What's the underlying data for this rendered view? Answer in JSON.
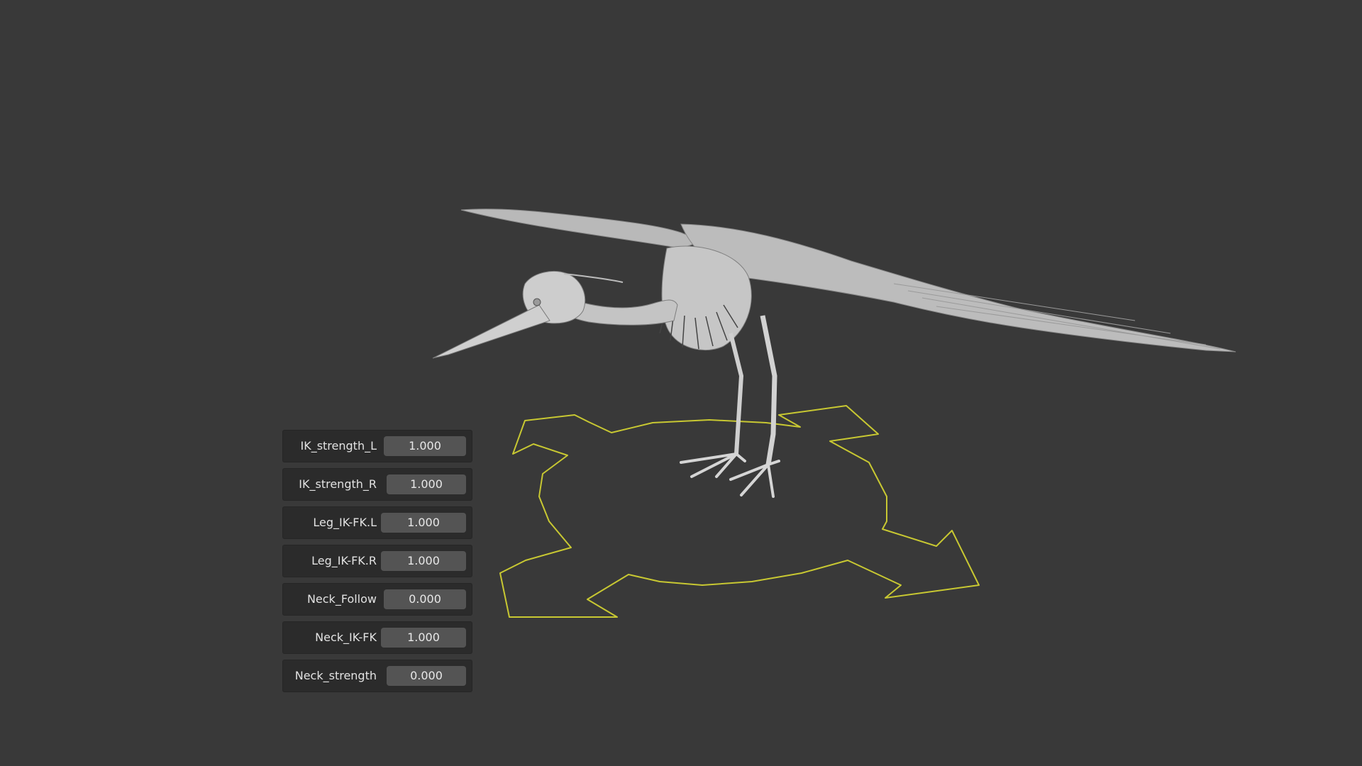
{
  "viewport": {
    "background": "#393939",
    "widget_color": "#c8c832",
    "model_color": "#c9c9c9"
  },
  "properties": [
    {
      "label": "IK_strength_L",
      "value": "1.000"
    },
    {
      "label": "IK_strength_R",
      "value": "1.000"
    },
    {
      "label": "Leg_IK-FK.L",
      "value": "1.000"
    },
    {
      "label": "Leg_IK-FK.R",
      "value": "1.000"
    },
    {
      "label": "Neck_Follow",
      "value": "0.000"
    },
    {
      "label": "Neck_IK-FK",
      "value": "1.000"
    },
    {
      "label": "Neck_strength",
      "value": "0.000"
    }
  ]
}
